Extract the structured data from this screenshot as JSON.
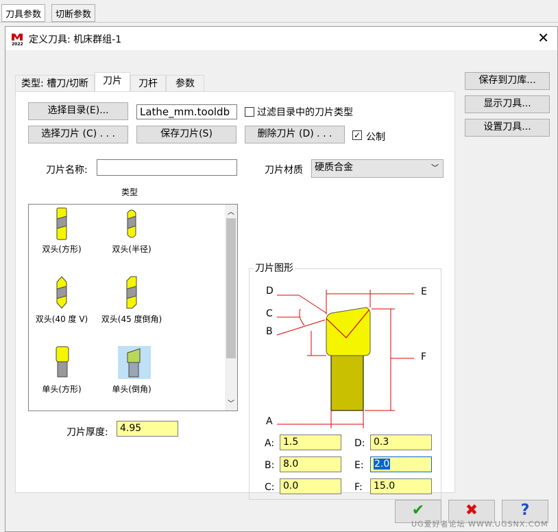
{
  "background_tabs": [
    "刀具参数",
    "切断参数"
  ],
  "dialog": {
    "title": "定义刀具: 机床群组-1",
    "logo_text": "2022",
    "close_symbol": "✕"
  },
  "tabs": [
    {
      "label": "类型: 槽刀/切断"
    },
    {
      "label": "刀片"
    },
    {
      "label": "刀杆"
    },
    {
      "label": "参数"
    }
  ],
  "right_buttons": {
    "save_to_lib": "保存到刀库...",
    "show_tool": "显示刀具...",
    "setup_tool": "设置刀具..."
  },
  "toolbar": {
    "select_catalog": "选择目录(E)...",
    "catalog_file": "Lathe_mm.tooldb",
    "filter_label": "过滤目录中的刀片类型",
    "filter_checked": "",
    "select_insert": "选择刀片 (C) . . .",
    "save_insert": "保存刀片(S)",
    "delete_insert": "删除刀片 (D) . . .",
    "metric_label": "公制",
    "metric_checked": "✓"
  },
  "insert_name_label": "刀片名称:",
  "insert_name_value": "",
  "material_label": "刀片材质",
  "material_value": "硬质合金",
  "type_label": "类型",
  "types": [
    {
      "label": "双头(方形)"
    },
    {
      "label": "双头(半径)"
    },
    {
      "label": "双头(40 度 V)"
    },
    {
      "label": "双头(45 度倒角)"
    },
    {
      "label": "单头(方形)"
    },
    {
      "label": "单头(倒角)"
    }
  ],
  "thickness_label": "刀片厚度:",
  "thickness_value": "4.95",
  "shape_group_label": "刀片图形",
  "diagram_labels": {
    "A": "A",
    "B": "B",
    "C": "C",
    "D": "D",
    "E": "E",
    "F": "F"
  },
  "params": {
    "A_label": "A:",
    "A": "1.5",
    "B_label": "B:",
    "B": "8.0",
    "C_label": "C:",
    "C": "0.0",
    "D_label": "D:",
    "D": "0.3",
    "E_label": "E:",
    "E": "2.0",
    "F_label": "F:",
    "F": "15.0"
  },
  "bottom_buttons": {
    "ok": "✔",
    "cancel": "✖",
    "help": "?"
  },
  "watermark": "UG爱好者论坛 WWW.UGSNX.COM",
  "colors": {
    "yellow_field": "#ffff99",
    "insert_yellow": "#f5f500",
    "shank": "#c8c000",
    "dim_red": "#e00000",
    "ok_green": "#1e9e1e",
    "cancel_red": "#d81010",
    "help_blue": "#2050c0",
    "select_highlight": "#bfe0f5"
  }
}
